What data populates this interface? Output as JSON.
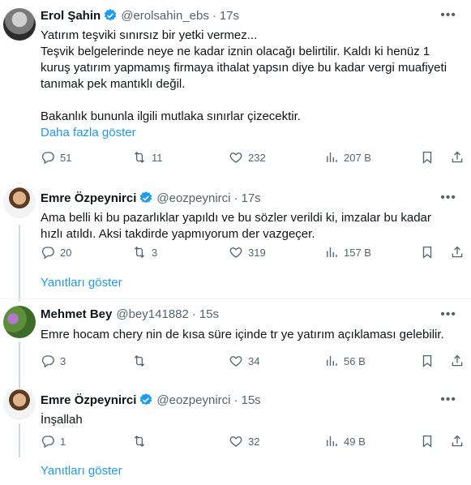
{
  "tweets": [
    {
      "name": "Erol Şahin",
      "handle": "@erolsahin_ebs",
      "time": "17s",
      "lines": [
        "Yatırım teşviki sınırsız bir yetki vermez...",
        "Teşvik belgelerinde neye ne kadar iznin olacağı belirtilir. Kaldı ki henüz 1",
        "kuruş yatırım yapmamış firmaya ithalat yapsın diye bu kadar vergi muafiyeti",
        "tanımak pek mantıklı değil.",
        "",
        "Bakanlık bununla ilgili mutlaka sınırlar çizecektir."
      ],
      "show_more": "Daha fazla göster",
      "replies": "51",
      "retweets": "11",
      "likes": "232",
      "views": "207 B"
    },
    {
      "name": "Emre Özpeynirci",
      "handle": "@eozpeynirci",
      "time": "17s",
      "lines": [
        "Ama belli ki bu pazarlıklar yapıldı ve bu sözler verildi ki, imzalar bu kadar",
        "hızlı atıldı. Aksi takdirde yapmıyorum der vazgeçer."
      ],
      "replies": "20",
      "retweets": "3",
      "likes": "319",
      "views": "157 B"
    },
    {
      "name": "Mehmet Bey",
      "handle": "@bey141882",
      "time": "15s",
      "lines": [
        "Emre hocam chery nin de kısa süre içinde tr ye yatırım açıklaması gelebilir."
      ],
      "replies": "3",
      "retweets": "",
      "likes": "34",
      "views": "56 B"
    },
    {
      "name": "Emre Özpeynirci",
      "handle": "@eozpeynirci",
      "time": "15s",
      "lines": [
        "İnşallah"
      ],
      "replies": "1",
      "retweets": "",
      "likes": "32",
      "views": "49 B"
    }
  ],
  "show_replies": [
    "Yanıtları göster",
    "Yanıtları göster"
  ],
  "colors": {
    "accent": "#1d9bf0",
    "muted": "#536471",
    "line": "#cfd9de"
  }
}
